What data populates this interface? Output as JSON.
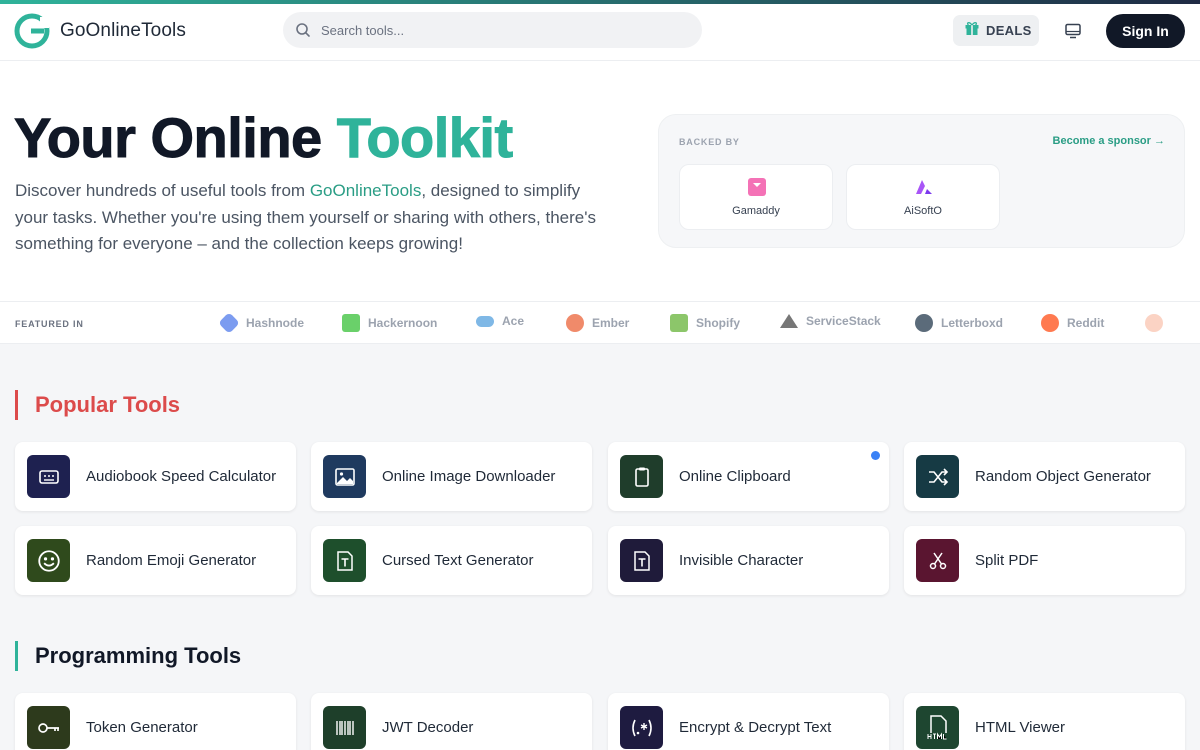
{
  "header": {
    "brand": "GoOnlineTools",
    "search_placeholder": "Search tools...",
    "deals_label": "DEALS",
    "signin_label": "Sign In"
  },
  "hero": {
    "title_part1": "Your Online ",
    "title_part2": "Toolkit",
    "desc_before": "Discover hundreds of useful tools from ",
    "desc_link": "GoOnlineTools",
    "desc_after": ", designed to simplify your tasks. Whether you're using them yourself or sharing with others, there's something for everyone – and the collection keeps growing!"
  },
  "sponsors": {
    "backed_by": "BACKED BY",
    "become": "Become a sponsor →",
    "items": [
      {
        "name": "Gamaddy",
        "icon": "gamaddy-logo"
      },
      {
        "name": "AiSoftO",
        "icon": "aisofto-logo"
      }
    ]
  },
  "featured": {
    "label": "FEATURED IN",
    "items": [
      {
        "name": "Hashnode",
        "color": "#7c9cf0"
      },
      {
        "name": "Hackernoon",
        "color": "#6ad06a"
      },
      {
        "name": "Ace",
        "color": "#7fb8e6"
      },
      {
        "name": "Ember",
        "color": "#f08a6a"
      },
      {
        "name": "Shopify",
        "color": "#8cc66a"
      },
      {
        "name": "ServiceStack",
        "color": "#777777"
      },
      {
        "name": "Letterboxd",
        "color": "#5b6b7a"
      },
      {
        "name": "Reddit",
        "color": "#ff7a50"
      }
    ]
  },
  "sections": {
    "popular_title": "Popular Tools",
    "programming_title": "Programming Tools"
  },
  "popular_tools": [
    {
      "name": "Audiobook Speed Calculator",
      "icon": "audiobook-icon",
      "color": "#1e2150"
    },
    {
      "name": "Online Image Downloader",
      "icon": "image-icon",
      "color": "#1f3a5f"
    },
    {
      "name": "Online Clipboard",
      "icon": "clipboard-icon",
      "color": "#1f3d2b",
      "badge": true
    },
    {
      "name": "Random Object Generator",
      "icon": "shuffle-icon",
      "color": "#163a44"
    },
    {
      "name": "Random Emoji Generator",
      "icon": "emoji-icon",
      "color": "#2f4a1c"
    },
    {
      "name": "Cursed Text Generator",
      "icon": "text-file-icon",
      "color": "#1e4f2c"
    },
    {
      "name": "Invisible Character",
      "icon": "text-file-icon",
      "color": "#1f1b3a"
    },
    {
      "name": "Split PDF",
      "icon": "scissors-icon",
      "color": "#5a1530"
    }
  ],
  "programming_tools": [
    {
      "name": "Token Generator",
      "icon": "key-icon",
      "color": "#2d3a1c"
    },
    {
      "name": "JWT Decoder",
      "icon": "barcode-icon",
      "color": "#1e3f2a"
    },
    {
      "name": "Encrypt & Decrypt Text",
      "icon": "regex-icon",
      "color": "#1e1b40"
    },
    {
      "name": "HTML Viewer",
      "icon": "html-file-icon",
      "color": "#1e4630"
    }
  ]
}
